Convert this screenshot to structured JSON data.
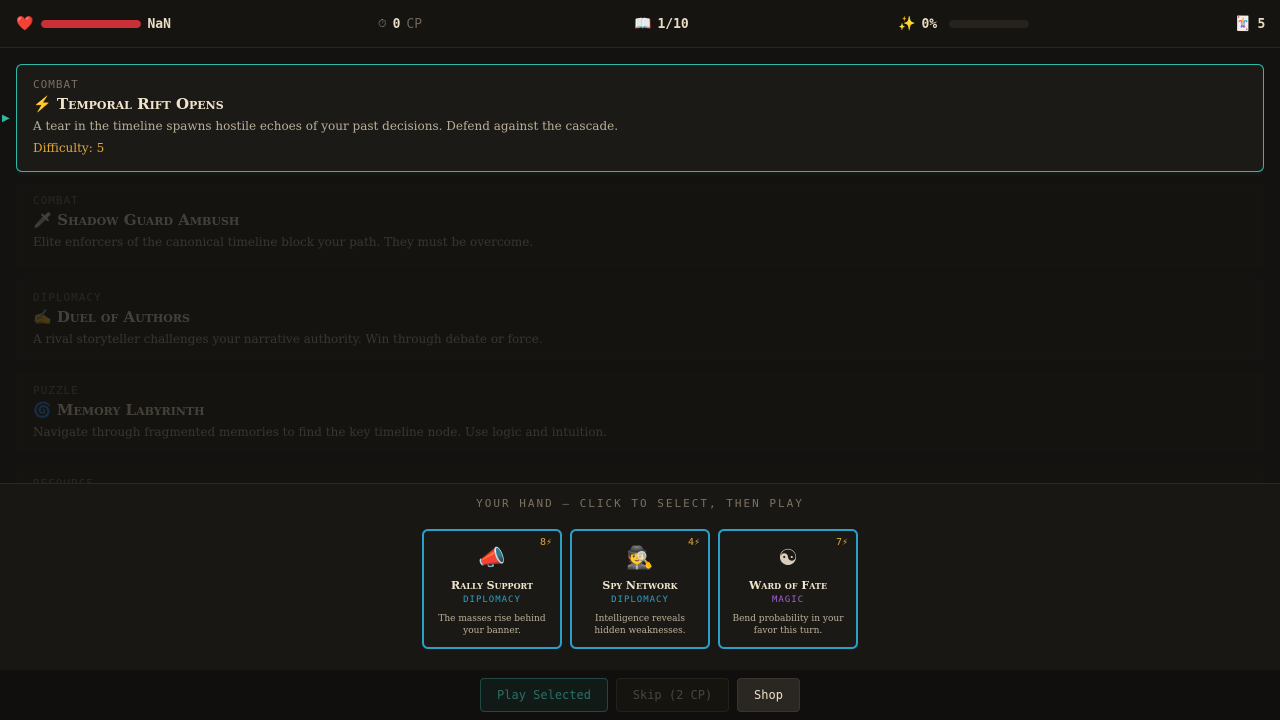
{
  "hud": {
    "health_icon": "heart-icon",
    "health_value": "NaN",
    "health_fraction": 1.0,
    "cp_icon": "clock-icon",
    "cp_value": "0",
    "cp_unit": "CP",
    "chapter_icon": "book-icon",
    "chapter": "1/10",
    "progress_icon": "sparkles-icon",
    "progress": "0%",
    "progress_fraction": 0,
    "cards_icon": "card-icon",
    "cards_count": "5"
  },
  "encounters": [
    {
      "type": "COMBAT",
      "icon": "⚡",
      "title": "Temporal Rift Opens",
      "desc": "A tear in the timeline spawns hostile echoes of your past decisions. Defend against the cascade.",
      "difficulty": "Difficulty: 5",
      "active": true
    },
    {
      "type": "COMBAT",
      "icon": "🗡",
      "title": "Shadow Guard Ambush",
      "desc": "Elite enforcers of the canonical timeline block your path. They must be overcome.",
      "active": false
    },
    {
      "type": "DIPLOMACY",
      "icon": "✍",
      "title": "Duel of Authors",
      "desc": "A rival storyteller challenges your narrative authority. Win through debate or force.",
      "active": false
    },
    {
      "type": "PUZZLE",
      "icon": "🌀",
      "title": "Memory Labyrinth",
      "desc": "Navigate through fragmented memories to find the key timeline node. Use logic and intuition.",
      "active": false
    },
    {
      "type": "RESOURCE",
      "active": false
    }
  ],
  "hand": {
    "title": "YOUR HAND — CLICK TO SELECT, THEN PLAY",
    "cards": [
      {
        "cost": "8⚡",
        "icon": "📣",
        "name": "Rally Support",
        "type": "DIPLOMACY",
        "type_color": "#2aa0c8",
        "desc": "The masses rise behind your banner."
      },
      {
        "cost": "4⚡",
        "icon": "🕵",
        "name": "Spy Network",
        "type": "DIPLOMACY",
        "type_color": "#2aa0c8",
        "desc": "Intelligence reveals hidden weaknesses."
      },
      {
        "cost": "7⚡",
        "icon": "☯",
        "name": "Ward of Fate",
        "type": "MAGIC",
        "type_color": "#a25fd6",
        "desc": "Bend probability in your favor this turn."
      }
    ]
  },
  "actions": {
    "play": "Play Selected",
    "skip": "Skip (2 CP)",
    "shop": "Shop"
  }
}
